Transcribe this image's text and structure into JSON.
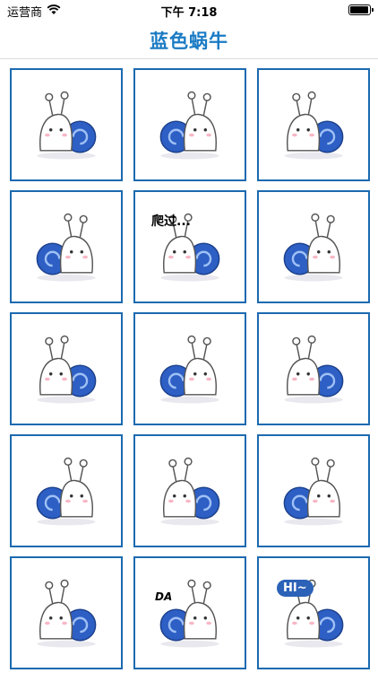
{
  "status_bar": {
    "carrier": "运营商",
    "time": "下午 7:18",
    "icons": [
      "wifi-icon",
      "battery-icon"
    ]
  },
  "nav": {
    "title": "蓝色蜗牛"
  },
  "colors": {
    "accent": "#1a7bc4",
    "cell_border": "#1c6ab0",
    "shell_blue": "#2d5fc4"
  },
  "stickers": [
    {
      "name": "snail-sticker-1",
      "caption": ""
    },
    {
      "name": "snail-sticker-2",
      "caption": ""
    },
    {
      "name": "snail-sticker-3",
      "caption": ""
    },
    {
      "name": "snail-sticker-4",
      "caption": ""
    },
    {
      "name": "snail-sticker-5",
      "caption": "爬过..."
    },
    {
      "name": "snail-sticker-6",
      "caption": ""
    },
    {
      "name": "snail-sticker-7",
      "caption": ""
    },
    {
      "name": "snail-sticker-8",
      "caption": ""
    },
    {
      "name": "snail-sticker-9",
      "caption": ""
    },
    {
      "name": "snail-sticker-10",
      "caption": ""
    },
    {
      "name": "snail-sticker-11",
      "caption": ""
    },
    {
      "name": "snail-sticker-12",
      "caption": ""
    },
    {
      "name": "snail-sticker-13",
      "caption": ""
    },
    {
      "name": "snail-sticker-14",
      "caption": "DA"
    },
    {
      "name": "snail-sticker-15",
      "caption": "HI~"
    }
  ]
}
